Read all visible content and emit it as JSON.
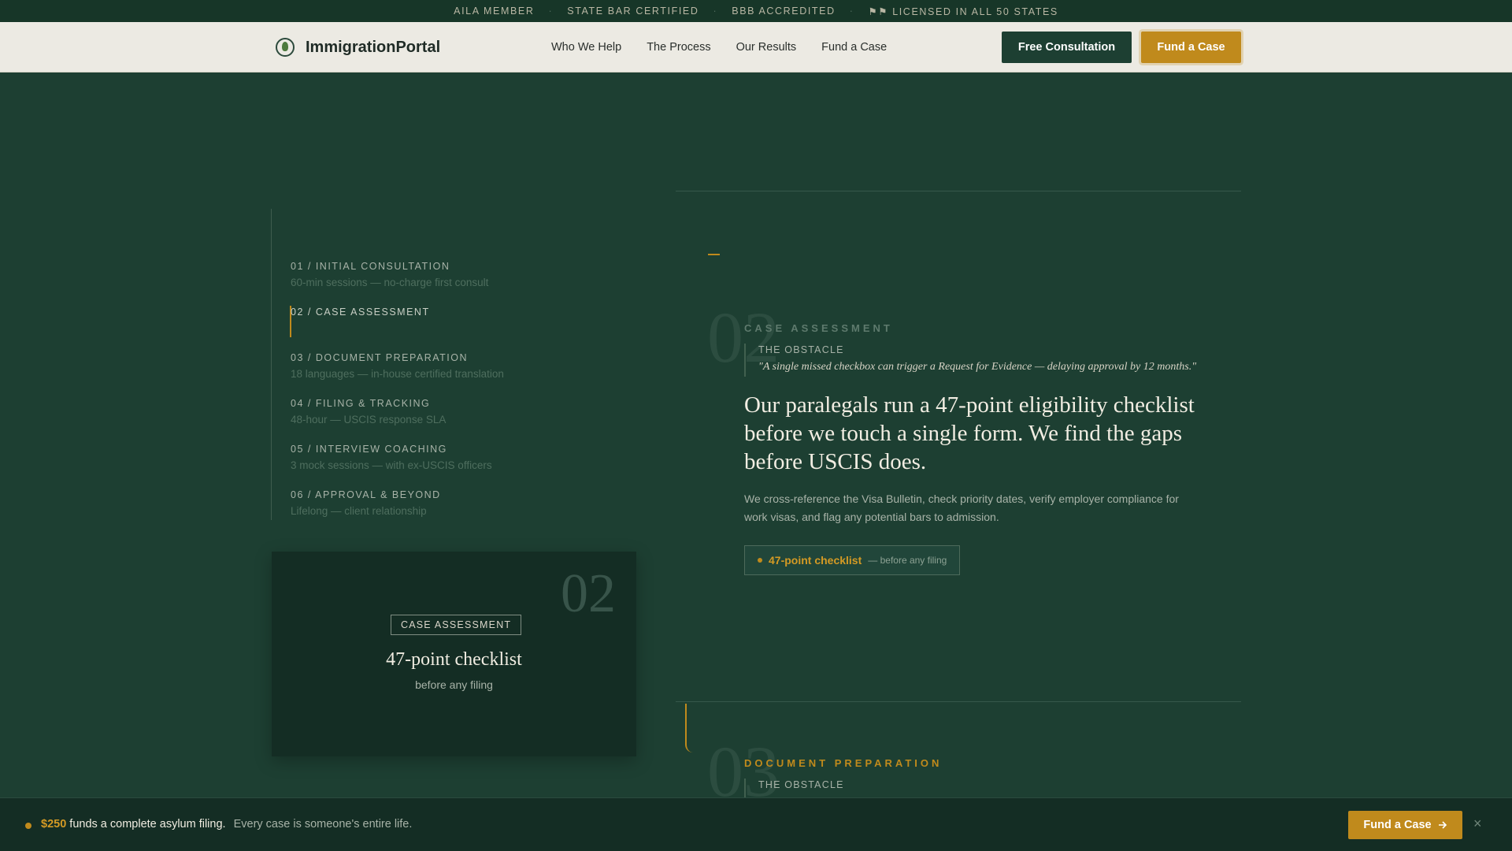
{
  "topbar": {
    "items": [
      "AILA MEMBER",
      "STATE BAR CERTIFIED",
      "BBB ACCREDITED",
      "LICENSED IN ALL 50 STATES"
    ],
    "separator": "·",
    "flag_glyph": "⚑⚑"
  },
  "header": {
    "logo_text": "ImmigrationPortal",
    "nav": [
      "Who We Help",
      "The Process",
      "Our Results",
      "Fund a Case"
    ],
    "consult_label": "Free Consultation",
    "fund_label": "Fund a Case"
  },
  "timeline": {
    "steps": [
      {
        "title": "01 / INITIAL CONSULTATION",
        "sub": "60-min sessions — no-charge first consult"
      },
      {
        "title": "02 / CASE ASSESSMENT",
        "sub": ""
      },
      {
        "title": "03 / DOCUMENT PREPARATION",
        "sub": "18 languages — in-house certified translation"
      },
      {
        "title": "04 / FILING & TRACKING",
        "sub": "48-hour — USCIS response SLA"
      },
      {
        "title": "05 / INTERVIEW COACHING",
        "sub": "3 mock sessions — with ex-USCIS officers"
      },
      {
        "title": "06 / APPROVAL & BEYOND",
        "sub": "Lifelong — client relationship"
      }
    ],
    "active_index": 1
  },
  "card": {
    "number": "02",
    "badge": "CASE ASSESSMENT",
    "title": "47-point checklist",
    "sub": "before any filing"
  },
  "section_02": {
    "number": "02",
    "label": "CASE ASSESSMENT",
    "obstacle_label": "THE OBSTACLE",
    "quote": "\"A single missed checkbox can trigger a Request for Evidence — delaying approval by 12 months.\"",
    "headline": "Our paralegals run a 47-point eligibility checklist before we touch a single form. We find the gaps before USCIS does.",
    "body": "We cross-reference the Visa Bulletin, check priority dates, verify employer compliance for work visas, and flag any potential bars to admission.",
    "pill_strong": "47-point checklist",
    "pill_note": "— before any filing"
  },
  "section_03": {
    "number": "03",
    "label": "DOCUMENT PREPARATION",
    "obstacle_label": "THE OBSTACLE"
  },
  "bottombar": {
    "amount": "$250",
    "main": "funds a complete asylum filing.",
    "note": "Every case is someone's entire life.",
    "button": "Fund a Case",
    "close": "×"
  },
  "colors": {
    "background": "#1d3f32",
    "accent": "#c08a1c",
    "header_bg": "#eceae3"
  }
}
